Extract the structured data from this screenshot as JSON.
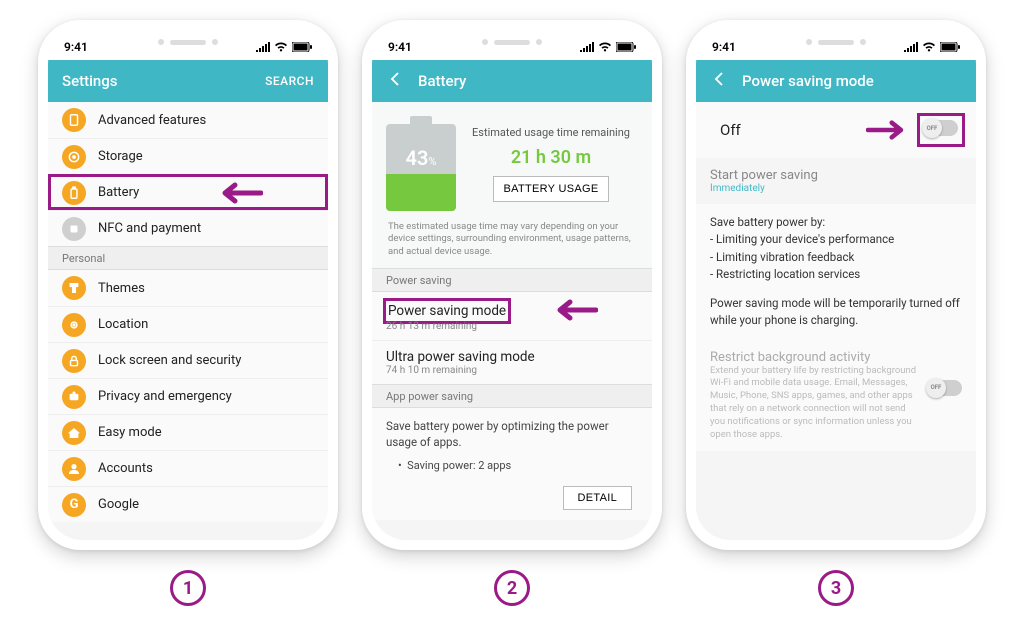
{
  "status": {
    "time": "9:41"
  },
  "step1": {
    "label": "1",
    "header": {
      "title": "Settings",
      "search": "SEARCH"
    },
    "rows": {
      "adv": "Advanced features",
      "storage": "Storage",
      "battery": "Battery",
      "nfc": "NFC and payment"
    },
    "section_personal": "Personal",
    "rows2": {
      "themes": "Themes",
      "location": "Location",
      "lock": "Lock screen and security",
      "privacy": "Privacy and emergency",
      "easy": "Easy mode",
      "accounts": "Accounts",
      "google": "Google"
    }
  },
  "step2": {
    "label": "2",
    "header": {
      "title": "Battery"
    },
    "battery": {
      "pct": "43",
      "est_label": "Estimated usage time remaining",
      "est_value": "21 h 30 m",
      "usage_btn": "BATTERY USAGE",
      "disclaimer": "The estimated usage time may vary depending on your device settings, surrounding environment, usage patterns, and actual device usage."
    },
    "section_power_saving": "Power saving",
    "psm": {
      "title": "Power saving mode",
      "sub": "26 h 13 m remaining"
    },
    "upsm": {
      "title": "Ultra power saving mode",
      "sub": "74 h 10 m remaining"
    },
    "section_app": "App power saving",
    "app": {
      "desc": "Save battery power by optimizing the power usage of apps.",
      "bullet": "Saving power: 2 apps",
      "detail_btn": "DETAIL"
    }
  },
  "step3": {
    "label": "3",
    "header": {
      "title": "Power saving mode"
    },
    "off_row": {
      "label": "Off",
      "toggle_text": "OFF"
    },
    "start": {
      "title": "Start power saving",
      "sub": "Immediately"
    },
    "body": {
      "heading": "Save battery power by:",
      "b1": "Limiting your device's performance",
      "b2": "Limiting vibration feedback",
      "b3": "Restricting location services",
      "note": "Power saving mode will be temporarily turned off while your phone is charging."
    },
    "restrict": {
      "title": "Restrict background activity",
      "desc": "Extend your battery life by restricting background Wi-Fi and mobile data usage. Email, Messages, Music, Phone, SNS apps, games, and other apps that rely on a network connection will not send you notifications or sync information unless you open those apps.",
      "toggle_text": "OFF"
    }
  }
}
